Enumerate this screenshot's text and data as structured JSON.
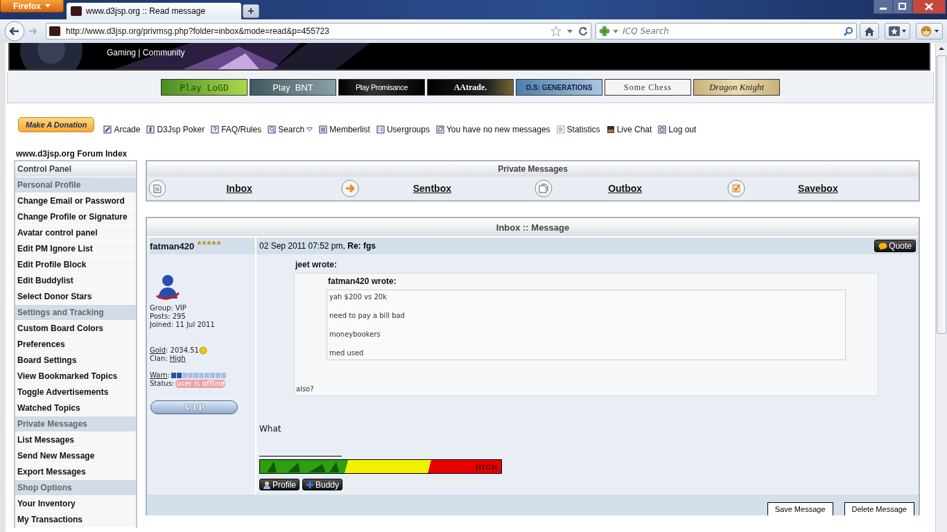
{
  "browser": {
    "menu_button": "Firefox",
    "tab_title": "www.d3jsp.org :: Read message",
    "new_tab": "+",
    "url": "http://www.d3jsp.org/privmsg.php?folder=inbox&mode=read&p=455723",
    "search_placeholder": "ICQ Search"
  },
  "banner": {
    "tagline": "Gaming | Community"
  },
  "partner_links": [
    {
      "label": "Play LoGD",
      "kind": "green"
    },
    {
      "label": "Play  BNT",
      "kind": "steel"
    },
    {
      "label": "Play Promisance",
      "kind": "dark"
    },
    {
      "label": "AAtrade.",
      "kind": "night"
    },
    {
      "label": "O.S: GENERATIONS",
      "kind": "sky"
    },
    {
      "label": "Some Chess",
      "kind": "light"
    },
    {
      "label": "Dragon Knight",
      "kind": "parchment"
    }
  ],
  "donate_button": "Make A Donation",
  "nav_links": [
    {
      "label": "Arcade",
      "kind": "arcade",
      "menu": false
    },
    {
      "label": "D3Jsp Poker",
      "kind": "poker",
      "menu": false
    },
    {
      "label": "FAQ/Rules",
      "kind": "faq",
      "menu": false
    },
    {
      "label": "Search",
      "kind": "search",
      "menu": true
    },
    {
      "label": "Memberlist",
      "kind": "list",
      "menu": false
    },
    {
      "label": "Usergroups",
      "kind": "groups",
      "menu": false
    },
    {
      "label": "You have no new messages",
      "kind": "messages",
      "menu": false
    },
    {
      "label": "Statistics",
      "kind": "stats",
      "menu": false
    },
    {
      "label": "Live Chat",
      "kind": "chat",
      "menu": false
    },
    {
      "label": "Log out",
      "kind": "logout",
      "menu": false
    }
  ],
  "breadcrumb": "www.d3jsp.org Forum Index",
  "sidebar": {
    "title": "Control Panel",
    "sections": [
      {
        "heading": "Personal Profile",
        "items": [
          "Change Email or Password",
          "Change Profile or Signature",
          "Avatar control panel",
          "Edit PM Ignore List",
          "Edit Profile Block",
          "Edit Buddylist",
          "Select Donor Stars"
        ]
      },
      {
        "heading": "Settings and Tracking",
        "items": [
          "Custom Board Colors",
          "Preferences",
          "Board Settings",
          "View Bookmarked Topics",
          "Toggle Advertisements",
          "Watched Topics"
        ]
      },
      {
        "heading": "Private Messages",
        "items": [
          "List Messages",
          "Send New Message",
          "Export Messages"
        ]
      },
      {
        "heading": "Shop Options",
        "items": [
          "Your Inventory",
          "My Transactions"
        ]
      }
    ]
  },
  "folders": {
    "title": "Private Messages",
    "items": [
      {
        "label": "Inbox",
        "kind": "inbox"
      },
      {
        "label": "Sentbox",
        "kind": "sent"
      },
      {
        "label": "Outbox",
        "kind": "outbox"
      },
      {
        "label": "Savebox",
        "kind": "save"
      }
    ]
  },
  "message": {
    "title": "Inbox :: Message",
    "author": {
      "name": "fatman420",
      "stars": 5,
      "details": [
        "Group: VIP",
        "Posts: 295",
        "Joined: 11 Jul 2011"
      ],
      "gold": {
        "link": "Gold",
        "text": ": 2034.51"
      },
      "clan": {
        "text": "Clan: ",
        "link": "High"
      },
      "warn": {
        "link": "Warn",
        "text": ":",
        "level": 0.2
      },
      "status": {
        "label": "Status:",
        "value": "user is offline"
      },
      "rank": "V I P"
    },
    "header": "02 Sep 2011 07:52 pm, **Re: fgs**",
    "quote_button": "Quote",
    "quote": {
      "author": "jeet wrote:",
      "inner": {
        "author": "fatman420 wrote:",
        "lines": [
          "yah $200 vs 20k",
          "need to pay a bill bad",
          "moneybookers",
          "med used"
        ]
      },
      "reply": "also?"
    },
    "text": "What",
    "signature": {
      "label": "HIGH"
    },
    "buttons": [
      {
        "label": "Profile",
        "kind": "profile"
      },
      {
        "label": "Buddy",
        "kind": "buddy"
      }
    ],
    "actions": [
      "Save Message",
      "Delete Message"
    ]
  }
}
